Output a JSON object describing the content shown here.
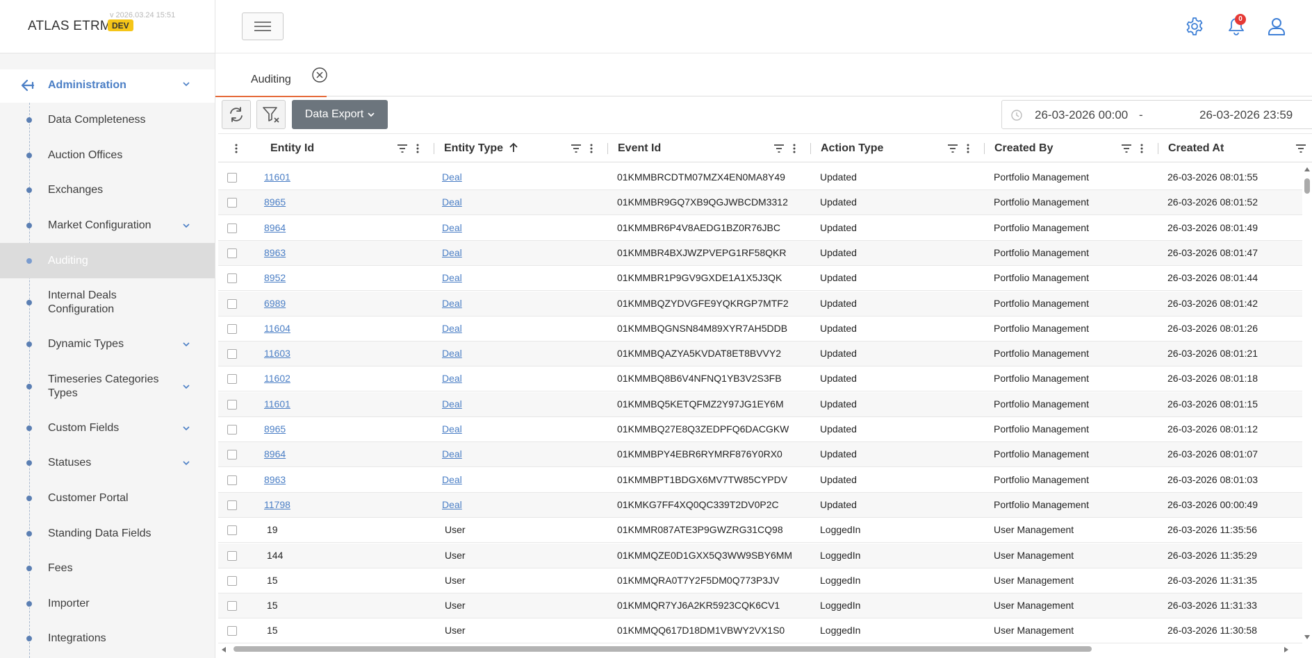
{
  "brand": {
    "name": "ATLAS ETRM",
    "badge": "DEV",
    "version": "v 2026.03.24 15:51"
  },
  "sidebar": {
    "section_label": "Administration",
    "items": [
      {
        "label": "Data Completeness",
        "chevron": false,
        "active": false
      },
      {
        "label": "Auction Offices",
        "chevron": false,
        "active": false
      },
      {
        "label": "Exchanges",
        "chevron": false,
        "active": false
      },
      {
        "label": "Market Configuration",
        "chevron": true,
        "active": false
      },
      {
        "label": "Auditing",
        "chevron": false,
        "active": true
      },
      {
        "label": "Internal Deals Configuration",
        "chevron": false,
        "active": false
      },
      {
        "label": "Dynamic Types",
        "chevron": true,
        "active": false
      },
      {
        "label": "Timeseries Categories Types",
        "chevron": true,
        "active": false
      },
      {
        "label": "Custom Fields",
        "chevron": true,
        "active": false
      },
      {
        "label": "Statuses",
        "chevron": true,
        "active": false
      },
      {
        "label": "Customer Portal",
        "chevron": false,
        "active": false
      },
      {
        "label": "Standing Data Fields",
        "chevron": false,
        "active": false
      },
      {
        "label": "Fees",
        "chevron": false,
        "active": false
      },
      {
        "label": "Importer",
        "chevron": false,
        "active": false
      },
      {
        "label": "Integrations",
        "chevron": false,
        "active": false
      }
    ]
  },
  "header": {
    "notification_count": "0"
  },
  "tabs": {
    "active_label": "Auditing"
  },
  "toolbar": {
    "export_label": "Data Export",
    "date_from": "26-03-2026 00:00",
    "date_separator": "-",
    "date_to": "26-03-2026 23:59"
  },
  "grid": {
    "columns": [
      "Entity Id",
      "Entity Type",
      "Event Id",
      "Action Type",
      "Created By",
      "Created At"
    ],
    "rows": [
      [
        "11601",
        "Deal",
        "01KMMBRCDTM07MZX4EN0MA8Y49",
        "Updated",
        "Portfolio Management",
        "26-03-2026 08:01:55"
      ],
      [
        "8965",
        "Deal",
        "01KMMBR9GQ7XB9QGJWBCDM3312",
        "Updated",
        "Portfolio Management",
        "26-03-2026 08:01:52"
      ],
      [
        "8964",
        "Deal",
        "01KMMBR6P4V8AEDG1BZ0R76JBC",
        "Updated",
        "Portfolio Management",
        "26-03-2026 08:01:49"
      ],
      [
        "8963",
        "Deal",
        "01KMMBR4BXJWZPVEPG1RF58QKR",
        "Updated",
        "Portfolio Management",
        "26-03-2026 08:01:47"
      ],
      [
        "8952",
        "Deal",
        "01KMMBR1P9GV9GXDE1A1X5J3QK",
        "Updated",
        "Portfolio Management",
        "26-03-2026 08:01:44"
      ],
      [
        "6989",
        "Deal",
        "01KMMBQZYDVGFE9YQKRGP7MTF2",
        "Updated",
        "Portfolio Management",
        "26-03-2026 08:01:42"
      ],
      [
        "11604",
        "Deal",
        "01KMMBQGNSN84M89XYR7AH5DDB",
        "Updated",
        "Portfolio Management",
        "26-03-2026 08:01:26"
      ],
      [
        "11603",
        "Deal",
        "01KMMBQAZYA5KVDAT8ET8BVVY2",
        "Updated",
        "Portfolio Management",
        "26-03-2026 08:01:21"
      ],
      [
        "11602",
        "Deal",
        "01KMMBQ8B6V4NFNQ1YB3V2S3FB",
        "Updated",
        "Portfolio Management",
        "26-03-2026 08:01:18"
      ],
      [
        "11601",
        "Deal",
        "01KMMBQ5KETQFMZ2Y97JG1EY6M",
        "Updated",
        "Portfolio Management",
        "26-03-2026 08:01:15"
      ],
      [
        "8965",
        "Deal",
        "01KMMBQ27E8Q3ZEDPFQ6DACGKW",
        "Updated",
        "Portfolio Management",
        "26-03-2026 08:01:12"
      ],
      [
        "8964",
        "Deal",
        "01KMMBPY4EBR6RYMRF876Y0RX0",
        "Updated",
        "Portfolio Management",
        "26-03-2026 08:01:07"
      ],
      [
        "8963",
        "Deal",
        "01KMMBPT1BDGX6MV7TW85CYPDV",
        "Updated",
        "Portfolio Management",
        "26-03-2026 08:01:03"
      ],
      [
        "11798",
        "Deal",
        "01KMKG7FF4XQ0QC339T2DV0P2C",
        "Updated",
        "Portfolio Management",
        "26-03-2026 00:00:49"
      ],
      [
        "19",
        "User",
        "01KMMR087ATE3P9GWZRG31CQ98",
        "LoggedIn",
        "User Management",
        "26-03-2026 11:35:56"
      ],
      [
        "144",
        "User",
        "01KMMQZE0D1GXX5Q3WW9SBY6MM",
        "LoggedIn",
        "User Management",
        "26-03-2026 11:35:29"
      ],
      [
        "15",
        "User",
        "01KMMQRA0T7Y2F5DM0Q773P3JV",
        "LoggedIn",
        "User Management",
        "26-03-2026 11:31:35"
      ],
      [
        "15",
        "User",
        "01KMMQR7YJ6A2KR5923CQK6CV1",
        "LoggedIn",
        "User Management",
        "26-03-2026 11:31:33"
      ],
      [
        "15",
        "User",
        "01KMMQQ617D18DM1VBWY2VX1S0",
        "LoggedIn",
        "User Management",
        "26-03-2026 11:30:58"
      ]
    ]
  },
  "colors": {
    "accent": "#4a7ec5",
    "tab_underline": "#e56a3a",
    "badge": "#f5c518",
    "notification": "#e53935",
    "export_button": "#6c757d"
  }
}
